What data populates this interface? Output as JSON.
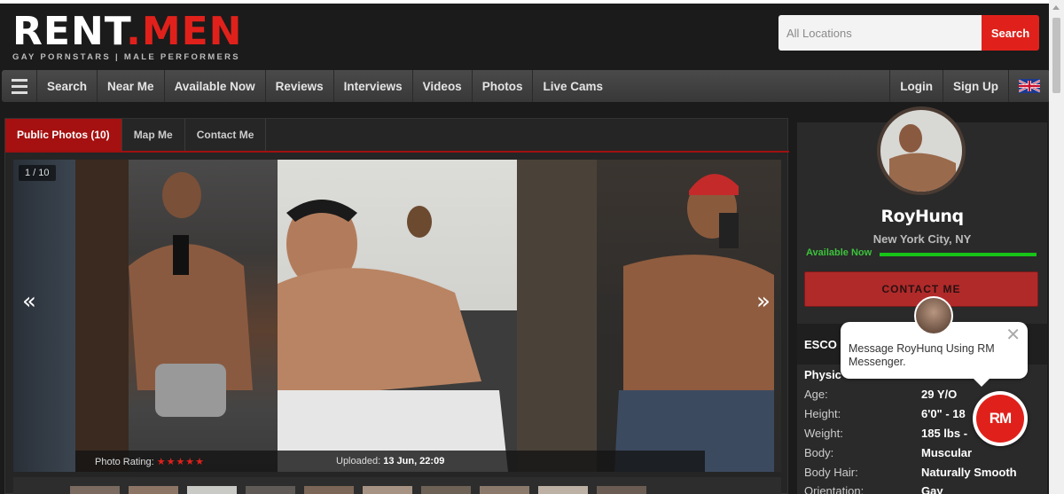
{
  "header": {
    "logo_rent": "RENT",
    "logo_dot": ".",
    "logo_men": "MEN",
    "tagline": "GAY PORNSTARS | MALE PERFORMERS",
    "search": {
      "placeholder": "All Locations",
      "button_label": "Search"
    }
  },
  "nav": {
    "items": [
      "Search",
      "Near Me",
      "Available Now",
      "Reviews",
      "Interviews",
      "Videos",
      "Photos",
      "Live Cams"
    ],
    "login": "Login",
    "signup": "Sign Up"
  },
  "tabs": [
    {
      "label": "Public Photos (10)",
      "active": true
    },
    {
      "label": "Map Me",
      "active": false
    },
    {
      "label": "Contact Me",
      "active": false
    }
  ],
  "gallery": {
    "counter": "1 / 10",
    "prev_arrow": "«",
    "next_arrow": "»",
    "rating_label": "Photo Rating:",
    "rating_stars": "★★★★★",
    "uploaded_label": "Uploaded:",
    "uploaded_value": "13 Jun, 22:09"
  },
  "profile": {
    "name": "RoyHunq",
    "location": "New York City, NY",
    "availability": "Available Now",
    "contact_button": "CONTACT ME",
    "section_heading": "ESCO",
    "physical_heading": "Physic",
    "attributes": [
      {
        "label": "Age:",
        "value": "29 Y/O"
      },
      {
        "label": "Height:",
        "value": "6'0\" - 18"
      },
      {
        "label": "Weight:",
        "value": "185 lbs -"
      },
      {
        "label": "Body:",
        "value": "Muscular"
      },
      {
        "label": "Body Hair:",
        "value": "Naturally Smooth"
      },
      {
        "label": "Orientation:",
        "value": "Gay"
      }
    ]
  },
  "messenger": {
    "message": "Message RoyHunq Using RM Messenger.",
    "close": "✕",
    "badge": "RM"
  },
  "colors": {
    "brand_red": "#e0211b",
    "active_tab": "#a51010",
    "available_green": "#17c417"
  }
}
